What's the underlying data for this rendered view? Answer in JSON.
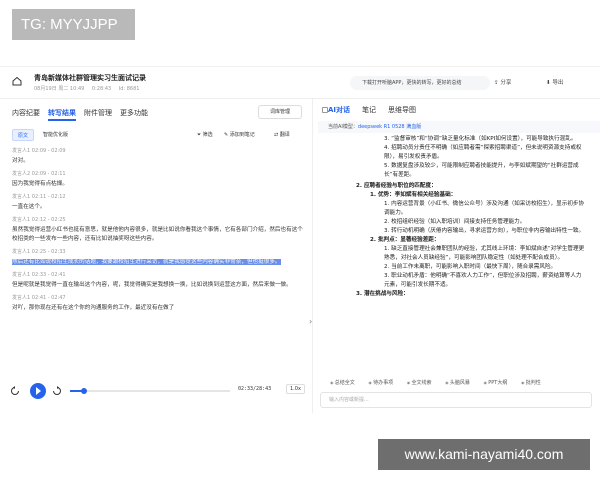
{
  "watermarks": {
    "top": "TG: MYYJJPP",
    "bottom": "www.kami-nayami40.com"
  },
  "header": {
    "title": "青岛新媒体社群管理实习生面试记录",
    "meta": [
      "08月19日 周二 10:49",
      "0:28:43",
      "Id: 8681"
    ],
    "promo": "下载打开听脑APP，更快的转写，更好的总结",
    "share": "分享",
    "export": "导出"
  },
  "left": {
    "tabs": [
      "内容纪要",
      "转写结果",
      "附件管理",
      "更多功能"
    ],
    "active_tab": 1,
    "vocab_button": "词库管理",
    "chips": {
      "original": "原文",
      "optimized": "智能优化版"
    },
    "tools": {
      "filter": "筛选",
      "add_note": "添加到笔记",
      "translate": "翻译"
    },
    "segments": [
      {
        "speaker": "发言人1 02:09 - 02:09",
        "text": "对对。",
        "highlight": false
      },
      {
        "speaker": "发言人2 02:09 - 02:11",
        "text": "因为我觉得有点枯燥。",
        "highlight": false
      },
      {
        "speaker": "发言人1 02:11 - 02:12",
        "text": "一直在这个。",
        "highlight": false
      },
      {
        "speaker": "发言人1 02:12 - 02:25",
        "text": "虽然我觉得运营小红书也挺有意思，就是他他内容很多，就是比如说你看我这个事情，它有各部门介绍，然后也有这个校招类的一些发布一些内容，还有比如说抽奖呀这些内容。",
        "highlight": false
      },
      {
        "speaker": "发言人1 02:25 - 02:33",
        "text": "然后还有比如说校招生成长的话题，我要跟校招生进行采访，就是我感觉这些内容确实非常奈，但也挺很多。",
        "highlight": true
      },
      {
        "speaker": "发言人1 02:33 - 02:41",
        "text": "但是呢就是我觉得一直在输出这个内容，呢，我觉得确实是我想换一换，比如说换到运营这方面，然后来做一做。",
        "highlight": false
      },
      {
        "speaker": "发言人1 02:41 - 02:47",
        "text": "对吖，那你现在还有在这个你的沟通服务的工作，最近没有在做了",
        "highlight": false
      }
    ],
    "player": {
      "time": "02:33/28:43",
      "speed": "1.0x",
      "progress": 0.089
    }
  },
  "right": {
    "tabs": [
      "AI对话",
      "笔记",
      "思维导图"
    ],
    "active_tab": 0,
    "model_label": "当前AI模型：",
    "model_name": "deepseek R1 0528 满血版",
    "answer_lines": [
      {
        "level": 3,
        "text": "3. “监督审核”和“协调”缺乏量化标准（如KPI如何设置），可能导致执行混乱。"
      },
      {
        "level": 3,
        "text": "4. 招聘动员分责任不明确（如应聘者需“探索招聘渠道”，但未说明资源支持或权限），易引发权责矛盾。"
      },
      {
        "level": 3,
        "text": "5. 数据复盘涉及较少，可能限制应聘者技能提升，与李如斌期望的“社群运营成长”有差距。"
      },
      {
        "level": 1,
        "text": "2. 应聘者经验与职位的匹配度：",
        "bold": true
      },
      {
        "level": 2,
        "text": "1. 优势：李如斌有相关经验基础：",
        "bold": true
      },
      {
        "level": 3,
        "text": "1. 内容运营背景（小红书、微信公众号）涉及沟通（如采访校招生），显示初步协调能力。"
      },
      {
        "level": 3,
        "text": "2. 校招组织经验（如入职培训）间接支持任务管理能力。"
      },
      {
        "level": 3,
        "text": "3. 转行动机明确（厌倦内容输出，寻求运营方向），与职位非内容输出特性一致。"
      },
      {
        "level": 2,
        "text": "2. 批判点：显著经验差距：",
        "bold": true
      },
      {
        "level": 3,
        "text": "1. 缺乏直接管理社会兼职团队的经验，尤其线上环境：李如斌自述“对学生管理更熟悉，对社会人员缺经验”，可能影响团队稳定性（如处理不配合成员）。"
      },
      {
        "level": 3,
        "text": "2. 当前工作未离职，可能影响入职时间（最快下周），随合录需风险。"
      },
      {
        "level": 3,
        "text": "3. 职业动机矛盾：他明确“不喜欢人力工作”，但职位涉及招聘，薪资结算等人力元素，可能引发长期不适。"
      },
      {
        "level": 1,
        "text": "3. 潜在挑战与风险：",
        "bold": true
      }
    ],
    "quick_actions": [
      "总结全文",
      "待办事项",
      "全文线索",
      "头脑风暴",
      "PPT大纲",
      "批判性"
    ],
    "input_placeholder": "输入内容或新提..."
  },
  "colors": {
    "accent": "#2563eb",
    "highlight": "#6a8fe8"
  }
}
